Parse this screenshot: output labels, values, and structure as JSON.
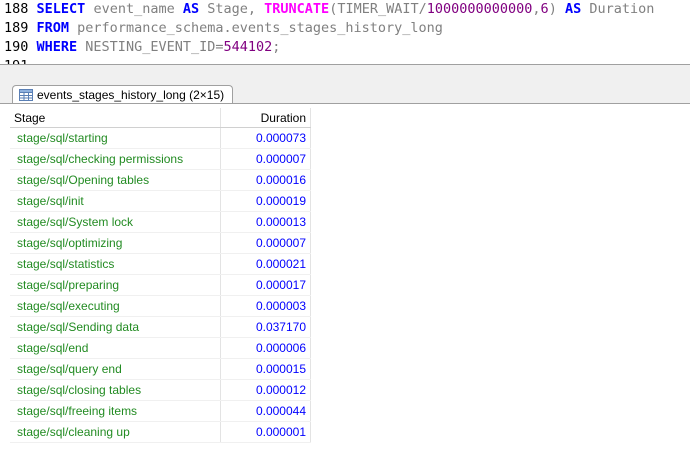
{
  "editor": {
    "lines": [
      {
        "number": "188",
        "tokens": [
          {
            "t": "SELECT",
            "c": "kw"
          },
          {
            "t": " event_name ",
            "c": "id"
          },
          {
            "t": "AS",
            "c": "kw"
          },
          {
            "t": " Stage, ",
            "c": "id"
          },
          {
            "t": "TRUNCATE",
            "c": "fn"
          },
          {
            "t": "(TIMER_WAIT/",
            "c": "id"
          },
          {
            "t": "1000000000000",
            "c": "num"
          },
          {
            "t": ",",
            "c": "id"
          },
          {
            "t": "6",
            "c": "num"
          },
          {
            "t": ") ",
            "c": "id"
          },
          {
            "t": "AS",
            "c": "kw"
          },
          {
            "t": " Duration",
            "c": "id"
          }
        ]
      },
      {
        "number": "189",
        "tokens": [
          {
            "t": "FROM",
            "c": "kw"
          },
          {
            "t": " performance_schema.events_stages_history_long",
            "c": "id"
          }
        ]
      },
      {
        "number": "190",
        "tokens": [
          {
            "t": "WHERE",
            "c": "kw"
          },
          {
            "t": " NESTING_EVENT_ID=",
            "c": "id"
          },
          {
            "t": "544102",
            "c": "num"
          },
          {
            "t": ";",
            "c": "id"
          }
        ]
      },
      {
        "number": "191",
        "tokens": []
      }
    ]
  },
  "result_tab": {
    "label": "events_stages_history_long (2×15)",
    "icon": "table-grid-icon"
  },
  "grid": {
    "columns": [
      "Stage",
      "Duration"
    ],
    "rows": [
      [
        "stage/sql/starting",
        "0.000073"
      ],
      [
        "stage/sql/checking permissions",
        "0.000007"
      ],
      [
        "stage/sql/Opening tables",
        "0.000016"
      ],
      [
        "stage/sql/init",
        "0.000019"
      ],
      [
        "stage/sql/System lock",
        "0.000013"
      ],
      [
        "stage/sql/optimizing",
        "0.000007"
      ],
      [
        "stage/sql/statistics",
        "0.000021"
      ],
      [
        "stage/sql/preparing",
        "0.000017"
      ],
      [
        "stage/sql/executing",
        "0.000003"
      ],
      [
        "stage/sql/Sending data",
        "0.037170"
      ],
      [
        "stage/sql/end",
        "0.000006"
      ],
      [
        "stage/sql/query end",
        "0.000015"
      ],
      [
        "stage/sql/closing tables",
        "0.000012"
      ],
      [
        "stage/sql/freeing items",
        "0.000044"
      ],
      [
        "stage/sql/cleaning up",
        "0.000001"
      ]
    ]
  },
  "colors": {
    "keyword": "#0000ff",
    "function": "#ff00ff",
    "identifier": "#808080",
    "number": "#800080",
    "stage_text": "#228b22",
    "duration_text": "#0000ff"
  }
}
